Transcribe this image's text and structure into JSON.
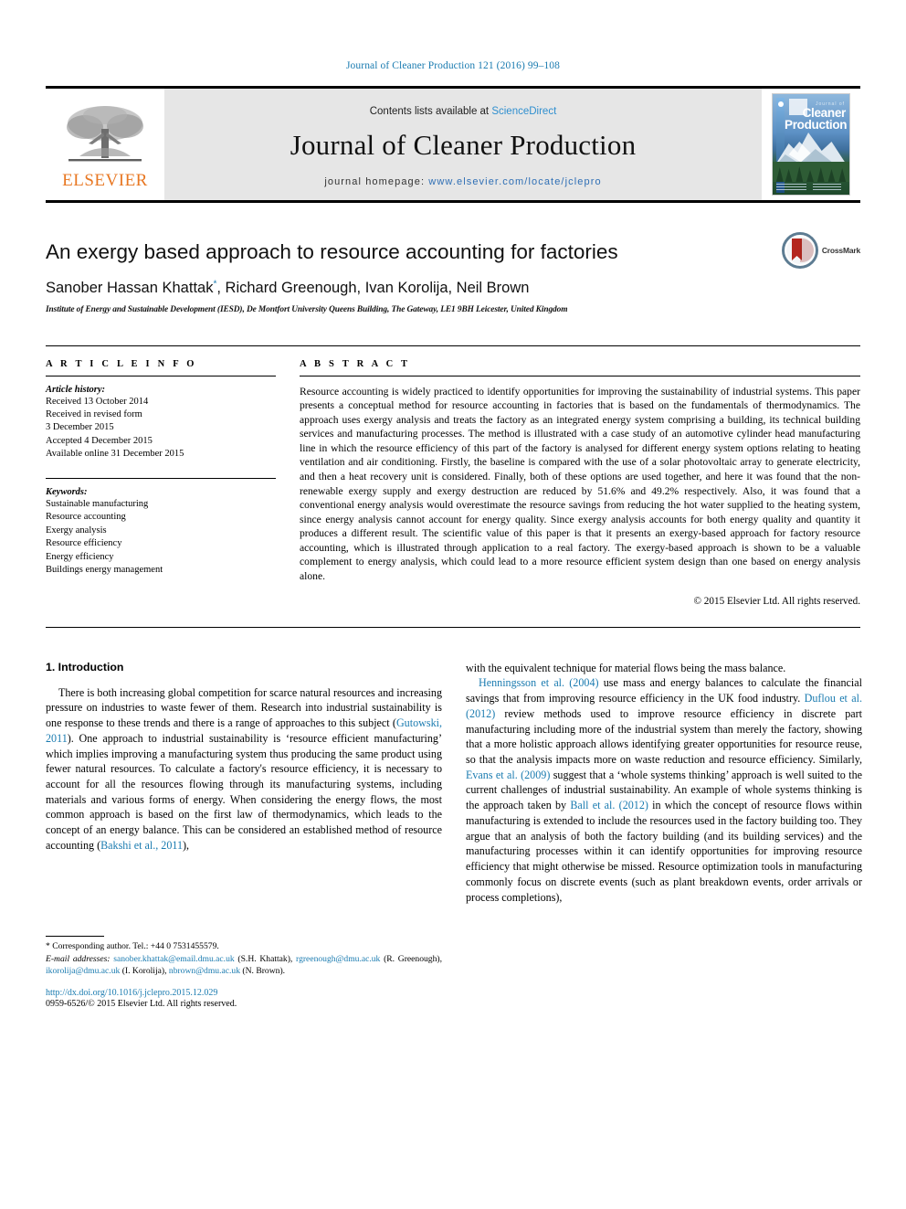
{
  "running_head": "Journal of Cleaner Production 121 (2016) 99–108",
  "masthead": {
    "elsevier_wordmark": "ELSEVIER",
    "contents_prefix": "Contents lists available at ",
    "contents_link": "ScienceDirect",
    "journal_title": "Journal of Cleaner Production",
    "homepage_prefix": "journal homepage: ",
    "homepage_url": "www.elsevier.com/locate/jclepro",
    "cover": {
      "small_title": "Journal of",
      "big_title_line1": "Cleaner",
      "big_title_line2": "Production"
    }
  },
  "title_block": {
    "title": "An exergy based approach to resource accounting for factories",
    "authors": "Sanober Hassan Khattak, Richard Greenough, Ivan Korolija, Neil Brown",
    "corresponding_marker": "*",
    "affiliation": "Institute of Energy and Sustainable Development (IESD), De Montfort University Queens Building, The Gateway, LE1 9BH Leicester, United Kingdom",
    "crossmark_label": "CrossMark"
  },
  "article_info": {
    "heading": "A R T I C L E   I N F O",
    "history_label": "Article history:",
    "history": [
      "Received 13 October 2014",
      "Received in revised form",
      "3 December 2015",
      "Accepted 4 December 2015",
      "Available online 31 December 2015"
    ],
    "keywords_label": "Keywords:",
    "keywords": [
      "Sustainable manufacturing",
      "Resource accounting",
      "Exergy analysis",
      "Resource efficiency",
      "Energy efficiency",
      "Buildings energy management"
    ]
  },
  "abstract": {
    "heading": "A B S T R A C T",
    "text": "Resource accounting is widely practiced to identify opportunities for improving the sustainability of industrial systems. This paper presents a conceptual method for resource accounting in factories that is based on the fundamentals of thermodynamics. The approach uses exergy analysis and treats the factory as an integrated energy system comprising a building, its technical building services and manufacturing processes. The method is illustrated with a case study of an automotive cylinder head manufacturing line in which the resource efficiency of this part of the factory is analysed for different energy system options relating to heating ventilation and air conditioning. Firstly, the baseline is compared with the use of a solar photovoltaic array to generate electricity, and then a heat recovery unit is considered. Finally, both of these options are used together, and here it was found that the non-renewable exergy supply and exergy destruction are reduced by 51.6% and 49.2% respectively. Also, it was found that a conventional energy analysis would overestimate the resource savings from reducing the hot water supplied to the heating system, since energy analysis cannot account for energy quality. Since exergy analysis accounts for both energy quality and quantity it produces a different result. The scientific value of this paper is that it presents an exergy-based approach for factory resource accounting, which is illustrated through application to a real factory. The exergy-based approach is shown to be a valuable complement to energy analysis, which could lead to a more resource efficient system design than one based on energy analysis alone.",
    "copyright": "© 2015 Elsevier Ltd. All rights reserved."
  },
  "body": {
    "section_number_title": "1. Introduction",
    "left_para_1_a": "There is both increasing global competition for scarce natural resources and increasing pressure on industries to waste fewer of them. Research into industrial sustainability is one response to these trends and there is a range of approaches to this subject (",
    "left_ref_1": "Gutowski, 2011",
    "left_para_1_b": "). One approach to industrial sustainability is ‘resource efficient manufacturing’ which implies improving a manufacturing system thus producing the same product using fewer natural resources. To calculate a factory's resource efficiency, it is necessary to account for all the resources flowing through its manufacturing systems, including materials and various forms of energy. When considering the energy flows, the most common approach is based on the first law of thermodynamics, which leads to the concept of an energy balance. This can be considered an established method of resource accounting (",
    "left_ref_2": "Bakshi et al., 2011",
    "left_para_1_c": "),",
    "right_para_a": "with the equivalent technique for material flows being the mass balance.",
    "right_ref_1": "Henningsson et al. (2004)",
    "right_para_b": " use mass and energy balances to calculate the financial savings that from improving resource efficiency in the UK food industry. ",
    "right_ref_2": "Duflou et al. (2012)",
    "right_para_c": " review methods used to improve resource efficiency in discrete part manufacturing including more of the industrial system than merely the factory, showing that a more holistic approach allows identifying greater opportunities for resource reuse, so that the analysis impacts more on waste reduction and resource efficiency. Similarly, ",
    "right_ref_3": "Evans et al. (2009)",
    "right_para_d": " suggest that a ‘whole systems thinking’ approach is well suited to the current challenges of industrial sustainability. An example of whole systems thinking is the approach taken by ",
    "right_ref_4": "Ball et al. (2012)",
    "right_para_e": " in which the concept of resource flows within manufacturing is extended to include the resources used in the factory building too. They argue that an analysis of both the factory building (and its building services) and the manufacturing processes within it can identify opportunities for improving resource efficiency that might otherwise be missed. Resource optimization tools in manufacturing commonly focus on discrete events (such as plant breakdown events, order arrivals or process completions),"
  },
  "footnote": {
    "corresponding": "* Corresponding author. Tel.: +44 0 7531455579.",
    "emails_label": "E-mail addresses:",
    "emails": [
      {
        "address": "sanober.khattak@email.dmu.ac.uk",
        "name": "(S.H. Khattak),"
      },
      {
        "address": "rgreenough@dmu.ac.uk",
        "name": "(R. Greenough),"
      },
      {
        "address": "ikorolija@dmu.ac.uk",
        "name": "(I. Korolija),"
      },
      {
        "address": "nbrown@dmu.ac.uk",
        "name": "(N. Brown)."
      }
    ],
    "doi": "http://dx.doi.org/10.1016/j.jclepro.2015.12.029",
    "issn": "0959-6526/© 2015 Elsevier Ltd. All rights reserved."
  },
  "colors": {
    "link_blue": "#1a7bb0",
    "elsevier_orange": "#e87722",
    "masthead_gray": "#e6e6e6"
  }
}
